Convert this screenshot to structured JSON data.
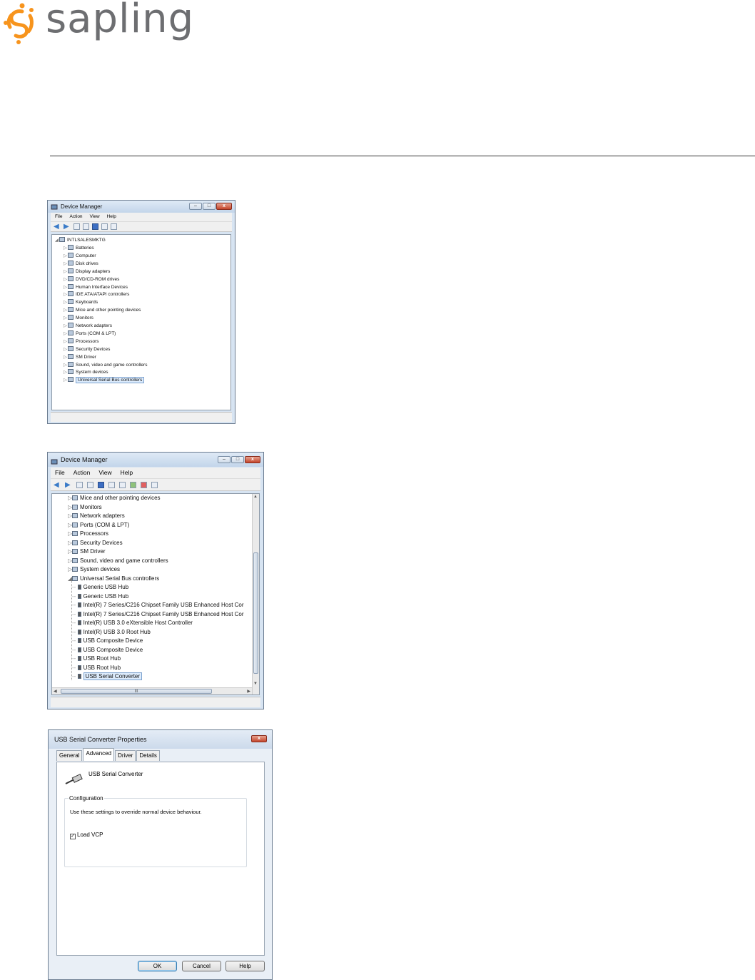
{
  "logo": {
    "text": "sapling",
    "accent": "#f7941d",
    "text_color": "#6d6e71"
  },
  "window1": {
    "title": "Device Manager",
    "menu": [
      "File",
      "Action",
      "View",
      "Help"
    ],
    "root": "INTLSALESMKTG",
    "items": [
      "Batteries",
      "Computer",
      "Disk drives",
      "Display adapters",
      "DVD/CD-ROM drives",
      "Human Interface Devices",
      "IDE ATA/ATAPI controllers",
      "Keyboards",
      "Mice and other pointing devices",
      "Monitors",
      "Network adapters",
      "Ports (COM & LPT)",
      "Processors",
      "Security Devices",
      "SM Driver",
      "Sound, video and game controllers",
      "System devices",
      "Universal Serial Bus controllers"
    ],
    "selected_index": 17
  },
  "window2": {
    "title": "Device Manager",
    "menu": [
      "File",
      "Action",
      "View",
      "Help"
    ],
    "items": [
      "Mice and other pointing devices",
      "Monitors",
      "Network adapters",
      "Ports (COM & LPT)",
      "Processors",
      "Security Devices",
      "SM Driver",
      "Sound, video and game controllers",
      "System devices",
      "Universal Serial Bus controllers"
    ],
    "usb_children": [
      "Generic USB Hub",
      "Generic USB Hub",
      "Intel(R) 7 Series/C216 Chipset Family USB Enhanced Host Cor",
      "Intel(R) 7 Series/C216 Chipset Family USB Enhanced Host Cor",
      "Intel(R) USB 3.0 eXtensible Host Controller",
      "Intel(R) USB 3.0 Root Hub",
      "USB Composite Device",
      "USB Composite Device",
      "USB Root Hub",
      "USB Root Hub",
      "USB Serial Converter"
    ],
    "selected_child_index": 10,
    "hscroll_label": "III"
  },
  "dialog": {
    "title": "USB Serial Converter Properties",
    "close": "x",
    "tabs": [
      "General",
      "Advanced",
      "Driver",
      "Details"
    ],
    "active_tab": "Advanced",
    "device_name": "USB Serial Converter",
    "group_label": "Configuration",
    "group_text": "Use these settings to override normal device behaviour.",
    "checkbox_label": "Load VCP",
    "checkbox_checked": true,
    "buttons": {
      "ok": "OK",
      "cancel": "Cancel",
      "help": "Help"
    }
  }
}
